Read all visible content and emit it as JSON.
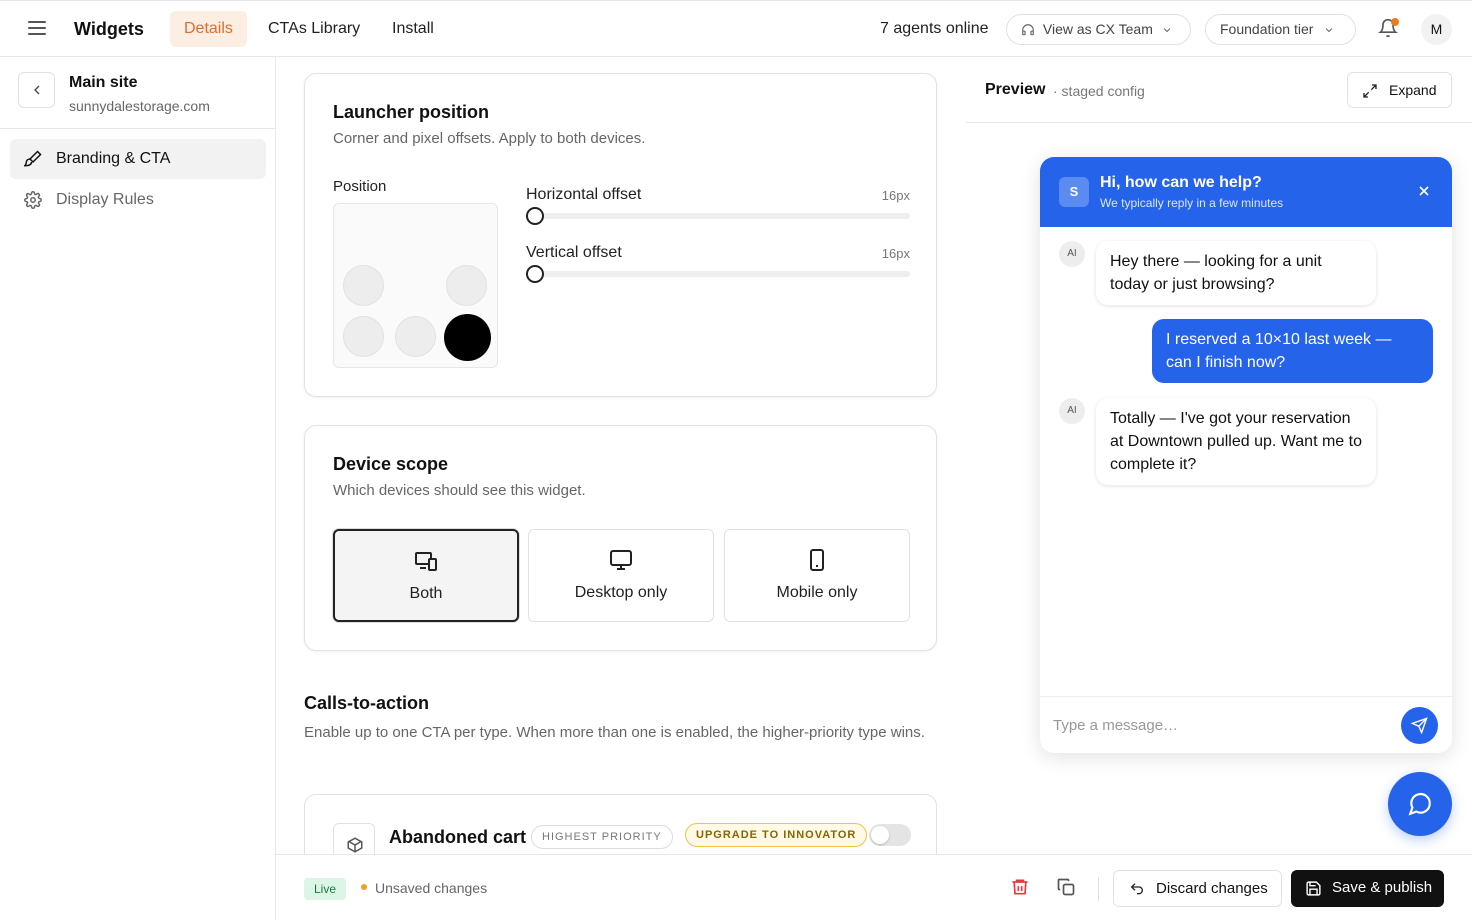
{
  "header": {
    "app_title": "Widgets",
    "tabs": [
      {
        "label": "Details",
        "active": true
      },
      {
        "label": "CTAs Library",
        "active": false
      },
      {
        "label": "Install",
        "active": false
      }
    ],
    "agents_online": "7 agents online",
    "view_as": "View as CX Team",
    "tier": "Foundation tier",
    "avatar_initial": "M",
    "accent_color": "#e06d2c"
  },
  "sidebar": {
    "site_name": "Main site",
    "site_domain": "sunnydalestorage.com",
    "items": [
      {
        "label": "Branding & CTA",
        "icon": "brush-icon",
        "active": true
      },
      {
        "label": "Display Rules",
        "icon": "gear-icon",
        "active": false
      }
    ]
  },
  "launcher": {
    "title": "Launcher position",
    "subtitle": "Corner and pixel offsets. Apply to both devices.",
    "position_label": "Position",
    "selected_position": "bottom-right",
    "horizontal": {
      "label": "Horizontal offset",
      "value": "16px",
      "level": 0
    },
    "vertical": {
      "label": "Vertical offset",
      "value": "16px",
      "level": 0
    }
  },
  "device_scope": {
    "title": "Device scope",
    "subtitle": "Which devices should see this widget.",
    "options": [
      {
        "label": "Both",
        "icon": "devices-icon",
        "selected": true
      },
      {
        "label": "Desktop only",
        "icon": "monitor-icon",
        "selected": false
      },
      {
        "label": "Mobile only",
        "icon": "phone-icon",
        "selected": false
      }
    ]
  },
  "ctas": {
    "title": "Calls-to-action",
    "subtitle": "Enable up to one CTA per type. When more than one is enabled, the higher-priority type wins.",
    "items": [
      {
        "name": "Abandoned cart",
        "icon": "box-icon",
        "priority": "HIGHEST PRIORITY",
        "upgrade": "UPGRADE TO INNOVATOR",
        "enabled": false
      }
    ]
  },
  "preview": {
    "title": "Preview",
    "subtitle": "· staged config",
    "expand_label": "Expand",
    "chat": {
      "logo": "S",
      "title": "Hi, how can we help?",
      "subtitle": "We typically reply in a few minutes",
      "ai_tag": "AI",
      "messages": [
        {
          "from": "bot",
          "text": "Hey there — looking for a unit today or just browsing?"
        },
        {
          "from": "user",
          "text": "I reserved a 10×10 last week — can I finish now?"
        },
        {
          "from": "bot",
          "text": "Totally — I've got your reservation at Downtown pulled up. Want me to complete it?"
        }
      ],
      "input_placeholder": "Type a message…",
      "brand_color": "#2563eb"
    }
  },
  "footer": {
    "status": "Live",
    "unsaved": "Unsaved changes",
    "discard_label": "Discard changes",
    "save_label": "Save & publish"
  }
}
